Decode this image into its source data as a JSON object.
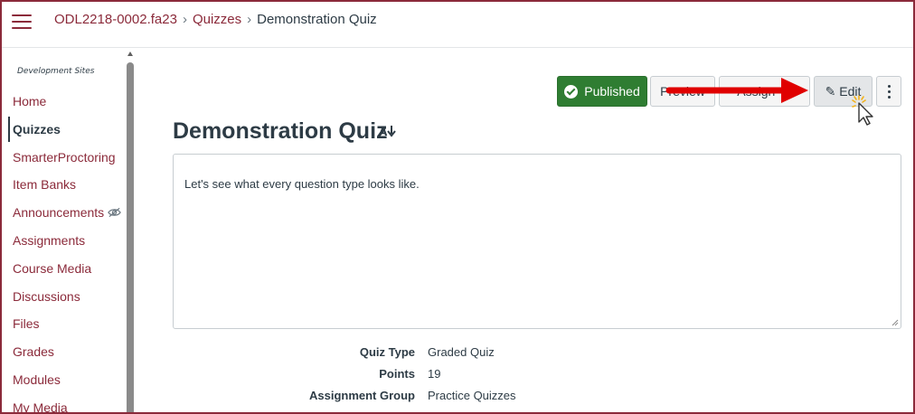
{
  "header": {
    "course": "ODL2218-0002.fa23",
    "section": "Quizzes",
    "current": "Demonstration Quiz",
    "separator": "›"
  },
  "sidebar": {
    "title": "Development Sites",
    "items": [
      {
        "label": "Home",
        "active": false
      },
      {
        "label": "Quizzes",
        "active": true
      },
      {
        "label": "SmarterProctoring",
        "active": false
      },
      {
        "label": "Item Banks",
        "active": false
      },
      {
        "label": "Announcements",
        "active": false,
        "icon": "eye-slash-icon"
      },
      {
        "label": "Assignments",
        "active": false
      },
      {
        "label": "Course Media",
        "active": false
      },
      {
        "label": "Discussions",
        "active": false
      },
      {
        "label": "Files",
        "active": false
      },
      {
        "label": "Grades",
        "active": false
      },
      {
        "label": "Modules",
        "active": false
      },
      {
        "label": "My Media",
        "active": false
      }
    ]
  },
  "toolbar": {
    "published_label": "Published",
    "preview_label": "Preview",
    "assign_label": "Assign To",
    "edit_label": "Edit",
    "more_icon": "kebab-icon"
  },
  "quiz": {
    "title": "Demonstration Quiz",
    "description": "Let's see what every question type looks like."
  },
  "details": [
    {
      "label": "Quiz Type",
      "value": "Graded Quiz"
    },
    {
      "label": "Points",
      "value": "19"
    },
    {
      "label": "Assignment Group",
      "value": "Practice Quizzes"
    }
  ],
  "colors": {
    "brand": "#8b2a3a",
    "published": "#2f7d32",
    "annotation_arrow": "#e00000"
  }
}
